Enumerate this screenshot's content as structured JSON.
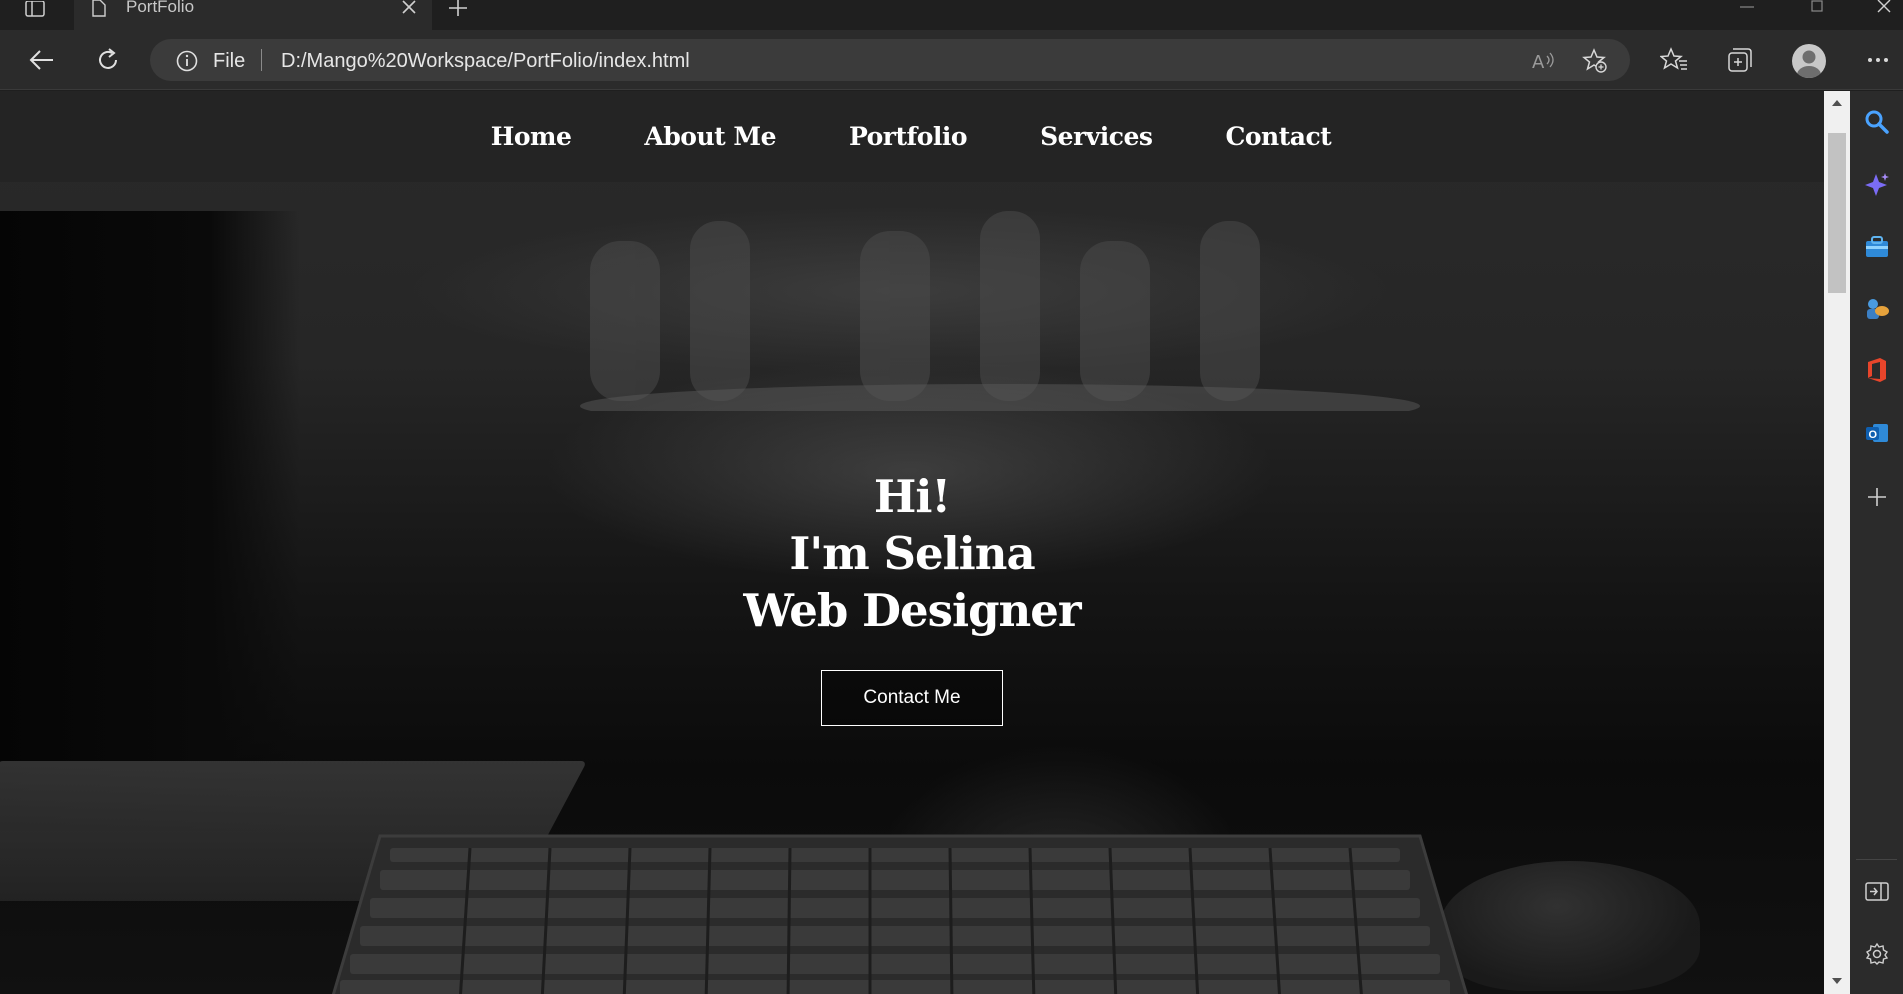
{
  "browser": {
    "tab_title": "PortFolio",
    "omnibox": {
      "scheme_label": "File",
      "url": "D:/Mango%20Workspace/PortFolio/index.html"
    }
  },
  "site": {
    "nav": [
      "Home",
      "About Me",
      "Portfolio",
      "Services",
      "Contact"
    ],
    "hero": {
      "line1": "Hi!",
      "line2": "I'm Selina",
      "line3": "Web Designer",
      "cta": "Contact Me"
    }
  },
  "colors": {
    "chrome_bg": "#1f1f1f",
    "toolbar_bg": "#2b2b2b",
    "omnibox_bg": "#3b3b3b",
    "nav_overlay": "#232323",
    "text": "#ffffff"
  },
  "icons": {
    "sidebar": [
      "search-icon",
      "copilot-icon",
      "shopping-icon",
      "games-icon",
      "office-icon",
      "outlook-icon",
      "add-icon"
    ],
    "sidebar_bottom": [
      "split-screen-icon",
      "settings-icon"
    ]
  }
}
